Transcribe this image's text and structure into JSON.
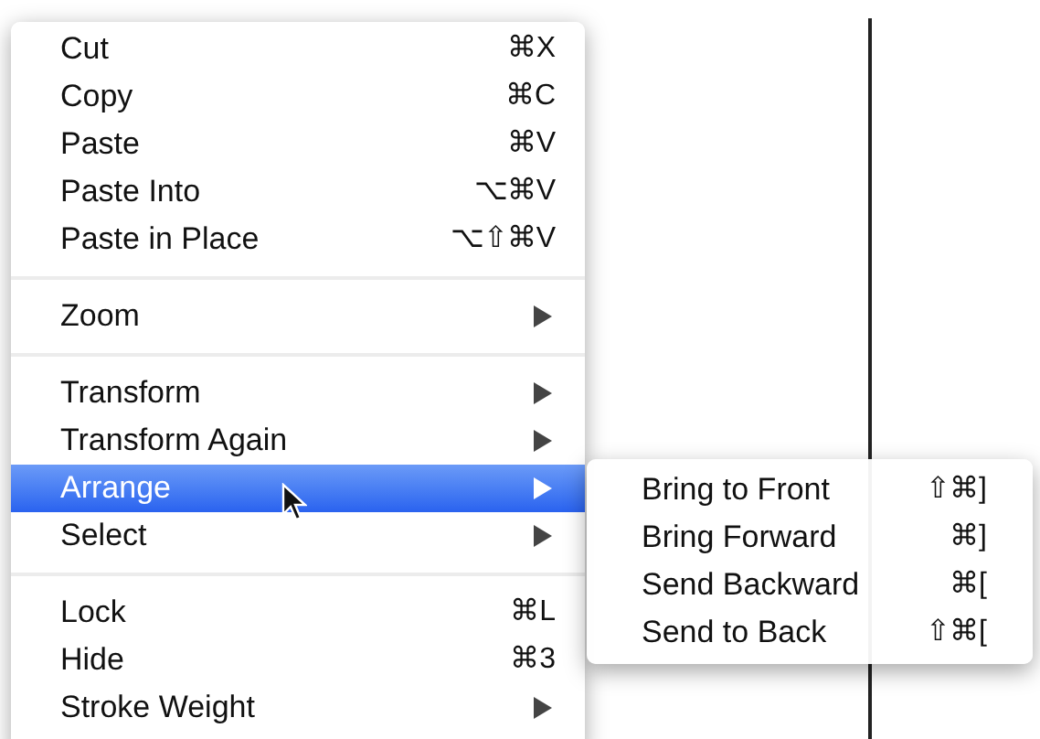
{
  "menu": {
    "items": [
      {
        "kind": "item",
        "label": "Cut",
        "shortcut": "⌘X",
        "has_submenu": false,
        "selected": false
      },
      {
        "kind": "item",
        "label": "Copy",
        "shortcut": "⌘C",
        "has_submenu": false,
        "selected": false
      },
      {
        "kind": "item",
        "label": "Paste",
        "shortcut": "⌘V",
        "has_submenu": false,
        "selected": false
      },
      {
        "kind": "item",
        "label": "Paste Into",
        "shortcut": "⌥⌘V",
        "has_submenu": false,
        "selected": false
      },
      {
        "kind": "item",
        "label": "Paste in Place",
        "shortcut": "⌥⇧⌘V",
        "has_submenu": false,
        "selected": false
      },
      {
        "kind": "separator"
      },
      {
        "kind": "item",
        "label": "Zoom",
        "has_submenu": true,
        "selected": false
      },
      {
        "kind": "separator"
      },
      {
        "kind": "item",
        "label": "Transform",
        "has_submenu": true,
        "selected": false
      },
      {
        "kind": "item",
        "label": "Transform Again",
        "has_submenu": true,
        "selected": false
      },
      {
        "kind": "item",
        "label": "Arrange",
        "has_submenu": true,
        "selected": true
      },
      {
        "kind": "item",
        "label": "Select",
        "has_submenu": true,
        "selected": false
      },
      {
        "kind": "separator"
      },
      {
        "kind": "item",
        "label": "Lock",
        "shortcut": "⌘L",
        "has_submenu": false,
        "selected": false
      },
      {
        "kind": "item",
        "label": "Hide",
        "shortcut": "⌘3",
        "has_submenu": false,
        "selected": false
      },
      {
        "kind": "item",
        "label": "Stroke Weight",
        "has_submenu": true,
        "selected": false
      }
    ]
  },
  "submenu": {
    "items": [
      {
        "label": "Bring to Front",
        "shortcut": "⇧⌘]"
      },
      {
        "label": "Bring Forward",
        "shortcut": "⌘]"
      },
      {
        "label": "Send Backward",
        "shortcut": "⌘["
      },
      {
        "label": "Send to Back",
        "shortcut": "⇧⌘["
      }
    ]
  }
}
